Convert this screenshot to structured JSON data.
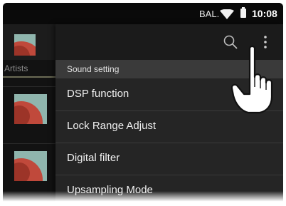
{
  "status_bar": {
    "carrier": "BAL.",
    "time": "10:08",
    "icons": [
      "wifi-icon",
      "battery-icon"
    ]
  },
  "background_app": {
    "tab_label": "Artists",
    "album_art_icon": "album-art-icon"
  },
  "menu": {
    "toolbar_icons": [
      "search-icon",
      "more-vert-icon"
    ],
    "section_title": "Sound setting",
    "items": [
      {
        "label": "DSP function"
      },
      {
        "label": "Lock Range Adjust"
      },
      {
        "label": "Digital filter"
      },
      {
        "label": "Upsampling Mode"
      }
    ]
  },
  "overlay": {
    "pointer": "tap-hand-icon"
  },
  "colors": {
    "menu_bg": "#252525",
    "section_bg": "#3a3a3a",
    "toolbar_bg": "#1b1b1b",
    "text": "#f0f0f0"
  }
}
